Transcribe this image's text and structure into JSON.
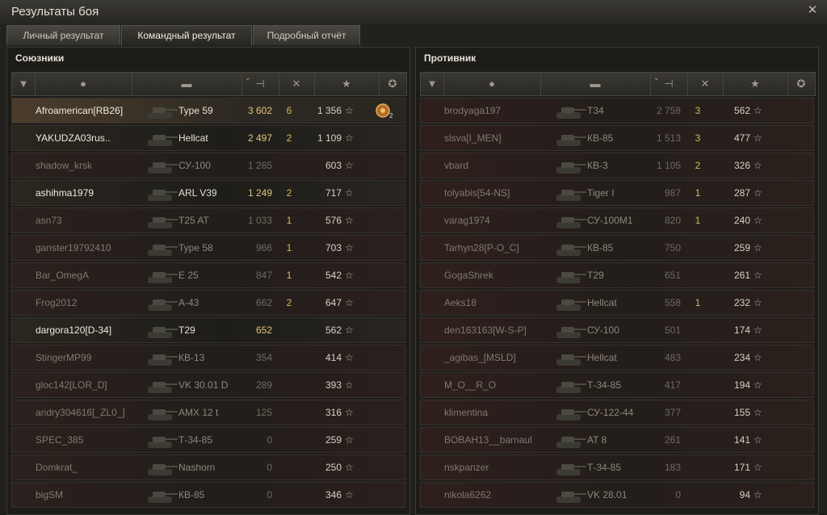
{
  "window": {
    "title": "Результаты боя",
    "close_icon": "close-icon"
  },
  "tabs": [
    {
      "label": "Личный результат",
      "active": false
    },
    {
      "label": "Командный результат",
      "active": true
    },
    {
      "label": "Подробный отчёт",
      "active": false
    }
  ],
  "columns": {
    "icons": [
      "tier-icon",
      "player-icon",
      "tank-icon",
      "damage-icon",
      "kills-icon",
      "xp-star-icon",
      "medal-icon"
    ],
    "sorted_icon": "sort-chevron-icon"
  },
  "colors": {
    "accent_gold": "#e3c57a",
    "kills": "#d8b460",
    "text_alive": "#efeade",
    "text_dead": "#7f7a70"
  },
  "allies": {
    "title": "Союзники",
    "players": [
      {
        "name": "Afroamerican[RB26]",
        "tank": "Type 59",
        "damage": "3 602",
        "kills": "6",
        "xp": "1 356",
        "alive": true,
        "highlight": true,
        "medal": "2"
      },
      {
        "name": "YAKUDZA03rus..",
        "tank": "Hellcat",
        "damage": "2 497",
        "kills": "2",
        "xp": "1 109",
        "alive": true
      },
      {
        "name": "shadow_krsk",
        "tank": "СУ-100",
        "damage": "1 265",
        "kills": "",
        "xp": "603",
        "alive": false
      },
      {
        "name": "ashihma1979",
        "tank": "ARL V39",
        "damage": "1 249",
        "kills": "2",
        "xp": "717",
        "alive": true
      },
      {
        "name": "asn73",
        "tank": "T25 AT",
        "damage": "1 033",
        "kills": "1",
        "xp": "576",
        "alive": false
      },
      {
        "name": "ganster19792410",
        "tank": "Type 58",
        "damage": "966",
        "kills": "1",
        "xp": "703",
        "alive": false
      },
      {
        "name": "Bar_OmegA",
        "tank": "E 25",
        "damage": "847",
        "kills": "1",
        "xp": "542",
        "alive": false
      },
      {
        "name": "Frog2012",
        "tank": "A-43",
        "damage": "662",
        "kills": "2",
        "xp": "647",
        "alive": false
      },
      {
        "name": "dargora120[D-34]",
        "tank": "T29",
        "damage": "652",
        "kills": "",
        "xp": "562",
        "alive": true
      },
      {
        "name": "StingerMP99",
        "tank": "КВ-13",
        "damage": "354",
        "kills": "",
        "xp": "414",
        "alive": false
      },
      {
        "name": "gloc142[LOR_D]",
        "tank": "VK 30.01 D",
        "damage": "289",
        "kills": "",
        "xp": "393",
        "alive": false
      },
      {
        "name": "andry304616[_ZL0_]",
        "tank": "AMX 12 t",
        "damage": "125",
        "kills": "",
        "xp": "316",
        "alive": false
      },
      {
        "name": "SPEC_385",
        "tank": "Т-34-85",
        "damage": "0",
        "kills": "",
        "xp": "259",
        "alive": false
      },
      {
        "name": "Domkrat_",
        "tank": "Nashorn",
        "damage": "0",
        "kills": "",
        "xp": "250",
        "alive": false
      },
      {
        "name": "bigSM",
        "tank": "КВ-85",
        "damage": "0",
        "kills": "",
        "xp": "346",
        "alive": false
      }
    ]
  },
  "enemies": {
    "title": "Противник",
    "players": [
      {
        "name": "brodyaga197",
        "tank": "T34",
        "damage": "2 758",
        "kills": "3",
        "xp": "562"
      },
      {
        "name": "slsva[I_MEN]",
        "tank": "КВ-85",
        "damage": "1 513",
        "kills": "3",
        "xp": "477"
      },
      {
        "name": "vbard",
        "tank": "КВ-3",
        "damage": "1 105",
        "kills": "2",
        "xp": "326"
      },
      {
        "name": "tolyabis[54-NS]",
        "tank": "Tiger I",
        "damage": "987",
        "kills": "1",
        "xp": "287"
      },
      {
        "name": "varag1974",
        "tank": "СУ-100М1",
        "damage": "820",
        "kills": "1",
        "xp": "240"
      },
      {
        "name": "Tarhyn28[P-O_C]",
        "tank": "КВ-85",
        "damage": "750",
        "kills": "",
        "xp": "259"
      },
      {
        "name": "GogaShrek",
        "tank": "T29",
        "damage": "651",
        "kills": "",
        "xp": "261"
      },
      {
        "name": "Aeks18",
        "tank": "Hellcat",
        "damage": "558",
        "kills": "1",
        "xp": "232"
      },
      {
        "name": "den163163[W-S-P]",
        "tank": "СУ-100",
        "damage": "501",
        "kills": "",
        "xp": "174"
      },
      {
        "name": "_agibas_[MSLD]",
        "tank": "Hellcat",
        "damage": "483",
        "kills": "",
        "xp": "234"
      },
      {
        "name": "M_O__R_O",
        "tank": "Т-34-85",
        "damage": "417",
        "kills": "",
        "xp": "194"
      },
      {
        "name": "klimentina",
        "tank": "СУ-122-44",
        "damage": "377",
        "kills": "",
        "xp": "155"
      },
      {
        "name": "BOBAH13__barnaul",
        "tank": "AT 8",
        "damage": "261",
        "kills": "",
        "xp": "141"
      },
      {
        "name": "nskpanzer",
        "tank": "Т-34-85",
        "damage": "183",
        "kills": "",
        "xp": "171"
      },
      {
        "name": "nikola6262",
        "tank": "VK 28.01",
        "damage": "0",
        "kills": "",
        "xp": "94"
      }
    ]
  }
}
